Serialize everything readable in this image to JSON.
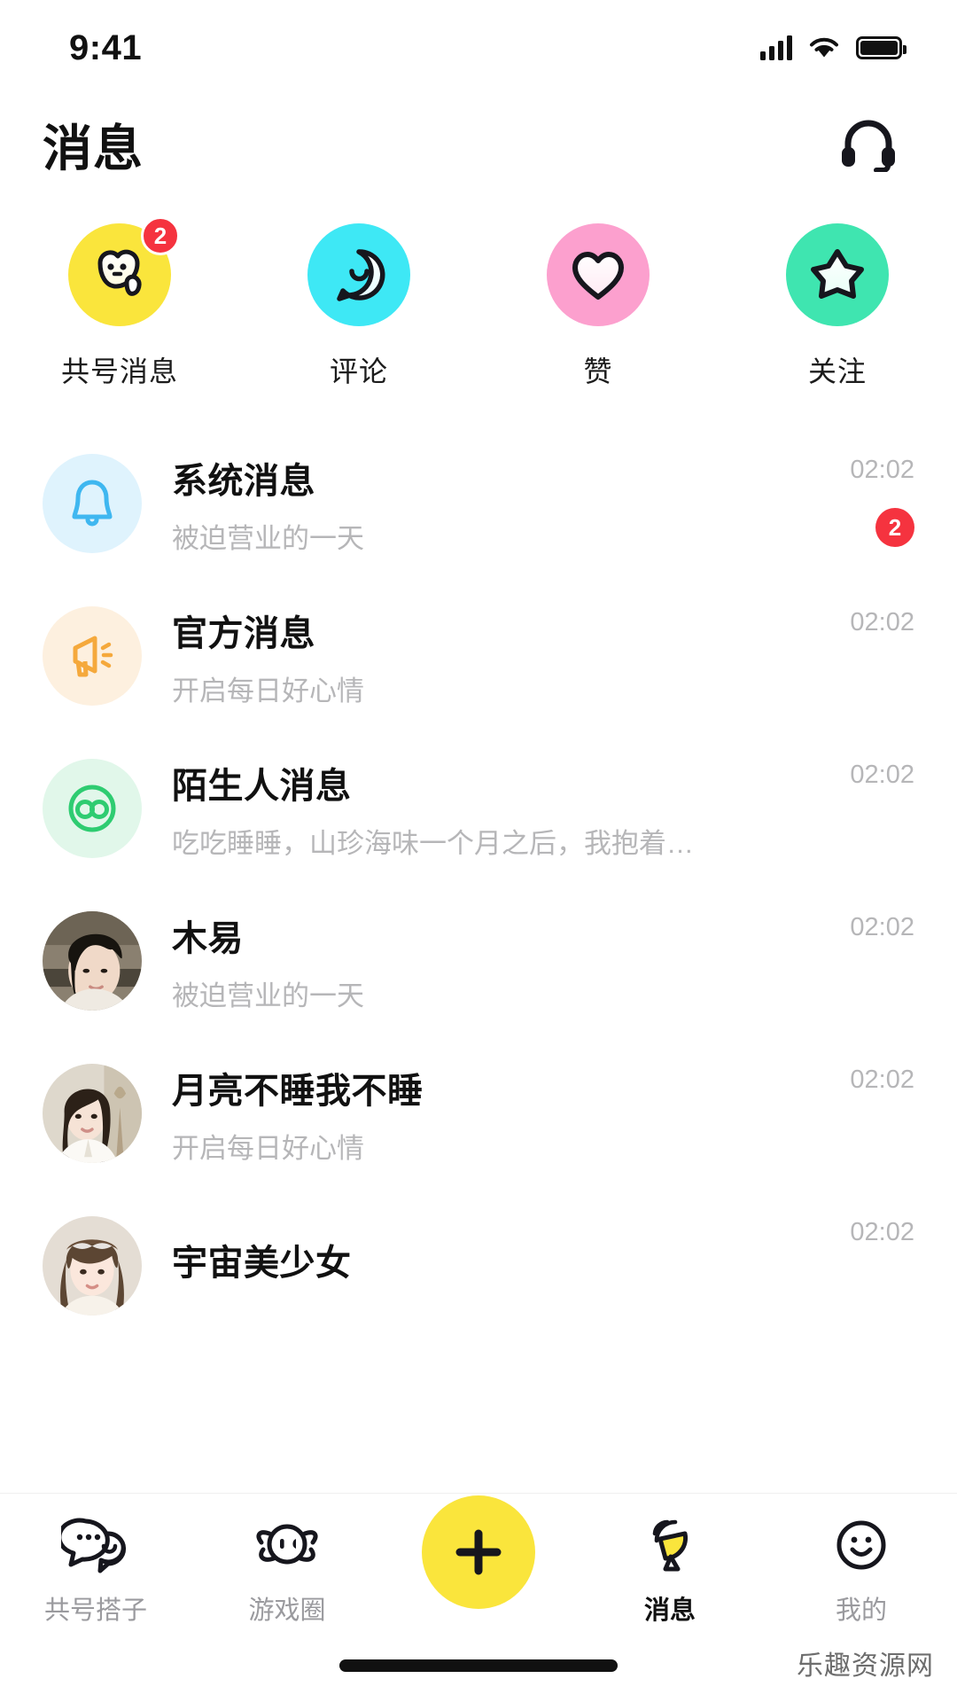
{
  "status_bar": {
    "time": "9:41",
    "signal_icon": "signal-bars-icon",
    "wifi_icon": "wifi-icon",
    "battery_icon": "battery-full-icon"
  },
  "header": {
    "title": "消息",
    "support_icon": "headset-icon"
  },
  "categories": [
    {
      "label": "共号消息",
      "icon": "blob-face-icon",
      "bg": "#FAE53C",
      "badge": "2"
    },
    {
      "label": "评论",
      "icon": "smile-bubble-icon",
      "bg": "#3EE8F5",
      "badge": ""
    },
    {
      "label": "赞",
      "icon": "heart-icon",
      "bg": "#FCA0CE",
      "badge": ""
    },
    {
      "label": "关注",
      "icon": "star-icon",
      "bg": "#3FE5B0",
      "badge": ""
    }
  ],
  "messages": [
    {
      "title": "系统消息",
      "preview": "被迫营业的一天",
      "time": "02:02",
      "badge": "2",
      "avatar_type": "icon",
      "avatar_icon": "bell-icon",
      "avatar_bg": "#DFF3FD",
      "avatar_color": "#3FB7F0"
    },
    {
      "title": "官方消息",
      "preview": "开启每日好心情",
      "time": "02:02",
      "badge": "",
      "avatar_type": "icon",
      "avatar_icon": "megaphone-icon",
      "avatar_bg": "#FDF0DF",
      "avatar_color": "#F5A93C"
    },
    {
      "title": "陌生人消息",
      "preview": "吃吃睡睡，山珍海味一个月之后，我抱着…",
      "time": "02:02",
      "badge": "",
      "avatar_type": "icon",
      "avatar_icon": "infinity-eyes-icon",
      "avatar_bg": "#E1F7EA",
      "avatar_color": "#2ECC71"
    },
    {
      "title": "木易",
      "preview": "被迫营业的一天",
      "time": "02:02",
      "badge": "",
      "avatar_type": "photo",
      "avatar_icon": "user-photo-male",
      "avatar_bg": "#6f6a5c",
      "avatar_color": "#1d1b18"
    },
    {
      "title": "月亮不睡我不睡",
      "preview": "开启每日好心情",
      "time": "02:02",
      "badge": "",
      "avatar_type": "photo",
      "avatar_icon": "user-photo-female-1",
      "avatar_bg": "#cfc9bd",
      "avatar_color": "#3a3028"
    },
    {
      "title": "宇宙美少女",
      "preview": "",
      "time": "02:02",
      "badge": "",
      "avatar_type": "photo",
      "avatar_icon": "user-photo-female-2",
      "avatar_bg": "#ded5cb",
      "avatar_color": "#584436"
    }
  ],
  "tab_bar": [
    {
      "label": "共号搭子",
      "icon": "double-chat-bubble-icon",
      "active": false
    },
    {
      "label": "游戏圈",
      "icon": "planet-face-icon",
      "active": false
    },
    {
      "label": "",
      "icon": "plus-icon",
      "active": false
    },
    {
      "label": "消息",
      "icon": "satellite-dish-icon",
      "active": true
    },
    {
      "label": "我的",
      "icon": "smiley-face-icon",
      "active": false
    }
  ],
  "watermark": "乐趣资源网",
  "colors": {
    "accent_yellow": "#FAE53C",
    "badge_red": "#F5333F",
    "text_primary": "#111111",
    "text_secondary": "#b6b6b8"
  }
}
